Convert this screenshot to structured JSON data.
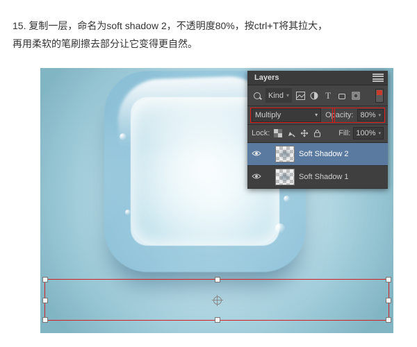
{
  "step": {
    "number": "15.",
    "text_line1": "15.  复制一层，命名为soft shadow 2，不透明度80%，按ctrl+T将其拉大，",
    "text_line2": "再用柔软的笔刷擦去部分让它变得更自然。"
  },
  "panel": {
    "title": "Layers",
    "filter": {
      "label": "Kind",
      "icons": [
        "image-icon",
        "adjustment-icon",
        "type-icon",
        "shape-icon",
        "smart-icon"
      ]
    },
    "blend": {
      "mode": "Multiply",
      "opacity_label": "Opacity:",
      "opacity_value": "80%"
    },
    "lock": {
      "label": "Lock:",
      "fill_label": "Fill:",
      "fill_value": "100%"
    },
    "layers": [
      {
        "name": "Soft Shadow 2",
        "visible": true,
        "selected": true
      },
      {
        "name": "Soft Shadow 1",
        "visible": true,
        "selected": false
      }
    ]
  },
  "colors": {
    "panel_bg": "#454545",
    "highlight": "#e01818",
    "selection": "#5a7aa0"
  }
}
